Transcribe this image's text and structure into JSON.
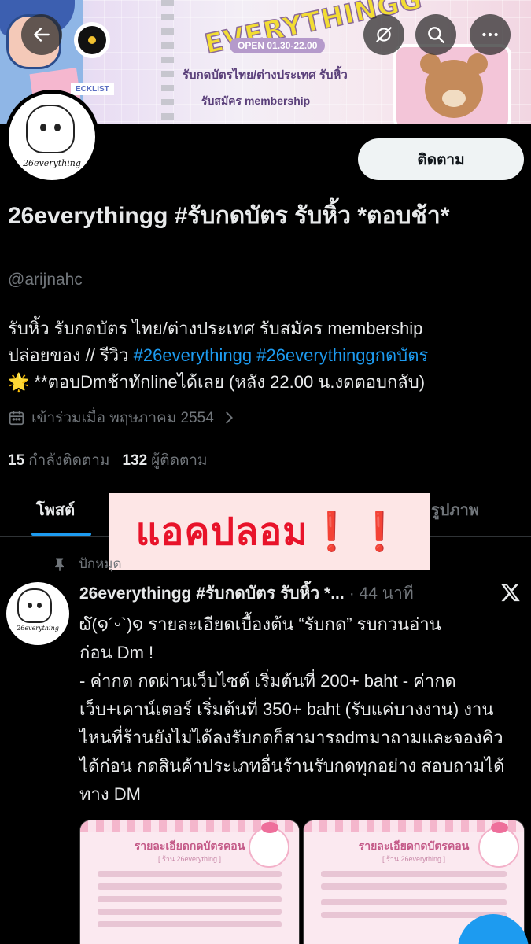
{
  "banner": {
    "title_art": "EVERYTHINGG",
    "open_hours": "OPEN 01.30-22.00",
    "line1": "รับกดบัตรไทย/ต่างประเทศ รับหิ้ว",
    "line2": "รับสมัคร membership",
    "checklist": "ECKLIST"
  },
  "top_buttons": {
    "back": "back-arrow-icon",
    "disc": "vinyl-disc-icon",
    "hide": "eye-slash-icon",
    "search": "search-icon",
    "more": "more-icon"
  },
  "avatar": {
    "brand": "26everything"
  },
  "follow_button": "ติดตาม",
  "profile": {
    "display_name": "26everythingg #รับกดบัตร รับหิ้ว *ตอบช้า*",
    "handle": "@arijnahc",
    "bio_line1": "รับหิ้ว รับกดบัตร ไทย/ต่างประเทศ รับสมัคร membership",
    "bio_line2_prefix": "ปล่อยของ // รีวิว ",
    "bio_tag1": "#26everythingg",
    "bio_tag2": "#26everythinggกดบัตร",
    "bio_line3": "🌟 **ตอบDmช้าทักlineได้เลย (หลัง 22.00 น.งดตอบกลับ)",
    "joined": "เข้าร่วมเมื่อ พฤษภาคม 2554",
    "following_count": "15",
    "following_label": "กำลังติดตาม",
    "followers_count": "132",
    "followers_label": "ผู้ติดตาม"
  },
  "tabs": {
    "posts": "โพสต์",
    "media": "รูปภาพ"
  },
  "overlay_label": "แอคปลอม❗️❗️",
  "pinned_label": "ปักหมุด",
  "post": {
    "name": "26everythingg #รับกดบัตร รับหิ้ว *...",
    "time": "· 44 นาที",
    "body_line1": "໖(໑´ᵕ`)໑ รายละเอียดเบื้องต้น “รับกด” รบกวนอ่าน",
    "body_line2": "ก่อน Dm !",
    "body_line3": "- ค่ากด กดผ่านเว็บไซต์ เริ่มต้นที่ 200+ baht - ค่ากด เว็บ+เคาน์เตอร์ เริ่มต้นที่ 350+ baht (รับแค่บางงาน) งานไหนที่ร้านยังไม่ได้ลงรับกดก็สามารถdmมาถามและจองคิวได้ก่อน กดสินค้าประเภทอื่นร้านรับกดทุกอย่าง สอบถามได้ทาง DM"
  },
  "media": [
    {
      "title": "รายละเอียดกดบัตรคอน",
      "subtitle": "[ ร้าน 26everything ]"
    },
    {
      "title": "รายละเอียดกดบัตรคอน",
      "subtitle": "[ ร้าน 26everything ]"
    }
  ],
  "colors": {
    "accent": "#1d9bf0",
    "background": "#000000",
    "warning_text": "#e8132a",
    "warning_bg": "#fde6e6"
  }
}
